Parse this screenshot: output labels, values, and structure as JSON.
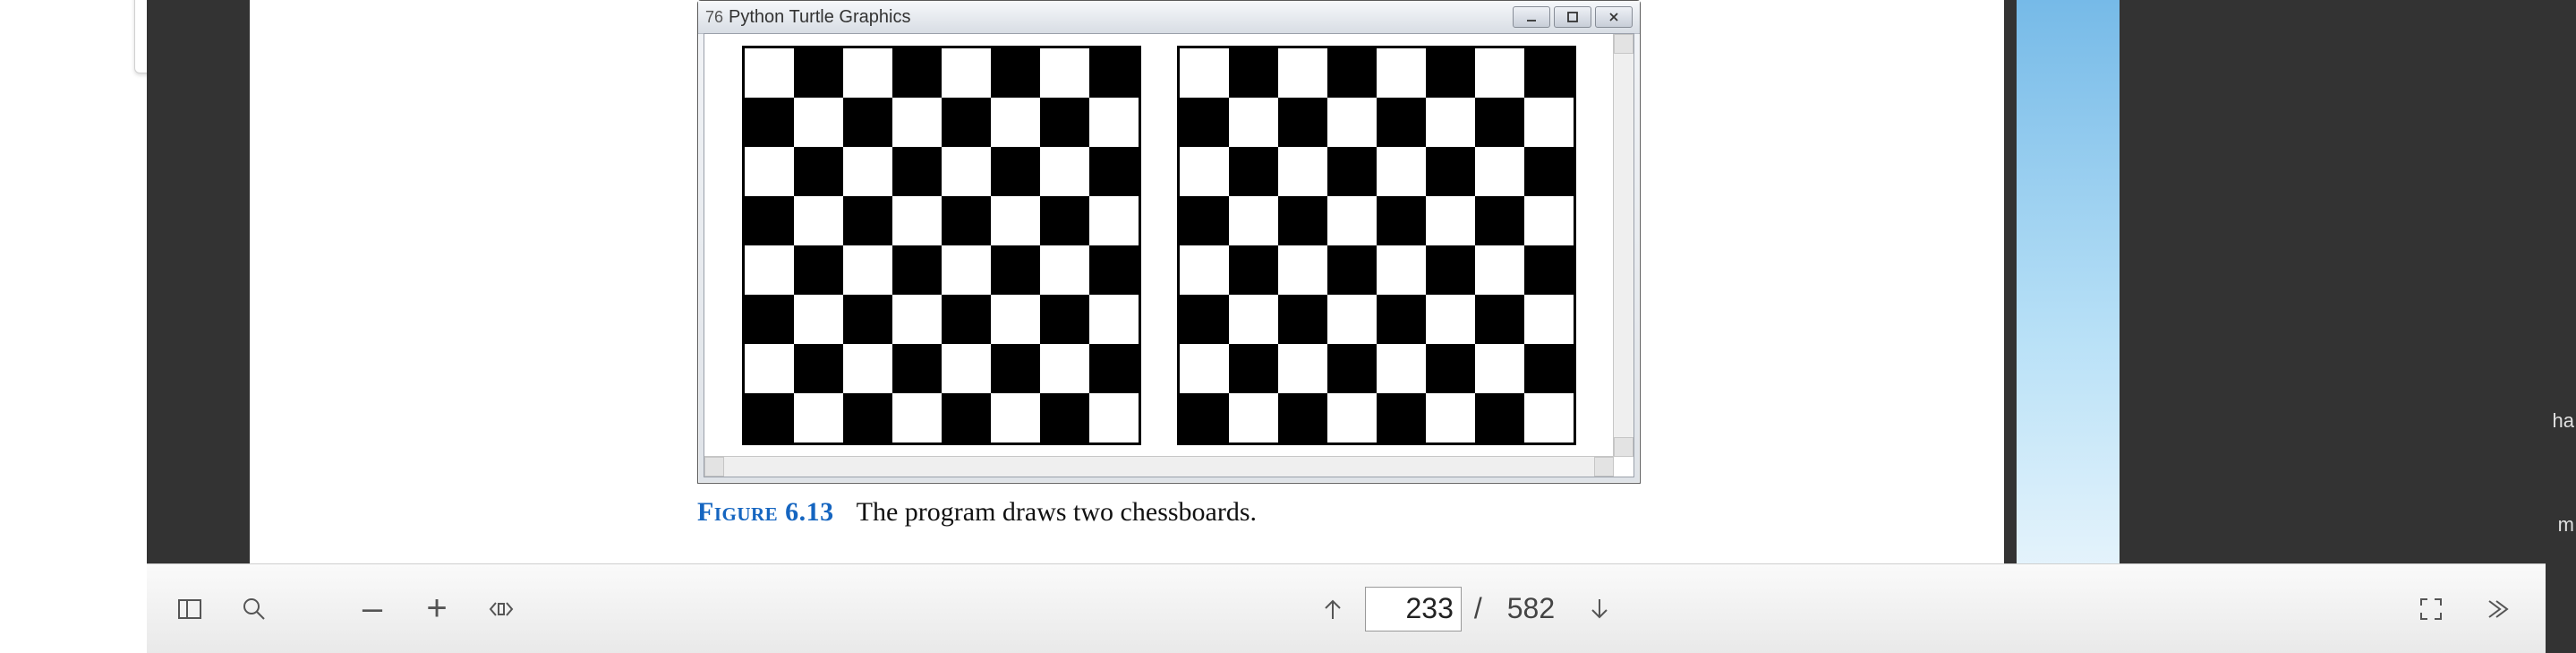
{
  "embedded_window": {
    "title": "Python Turtle Graphics",
    "tk_prefix": "76"
  },
  "figure": {
    "label": "Figure 6.13",
    "caption_text": "The program draws two chessboards."
  },
  "chessboard": {
    "rows": 8,
    "cols": 8,
    "count": 2
  },
  "toolbar": {
    "zoom_out": "–",
    "zoom_in": "+",
    "current_page": "233",
    "total_pages": "582",
    "separator": "/"
  },
  "right_margin_fragments": [
    "ha",
    "m"
  ]
}
